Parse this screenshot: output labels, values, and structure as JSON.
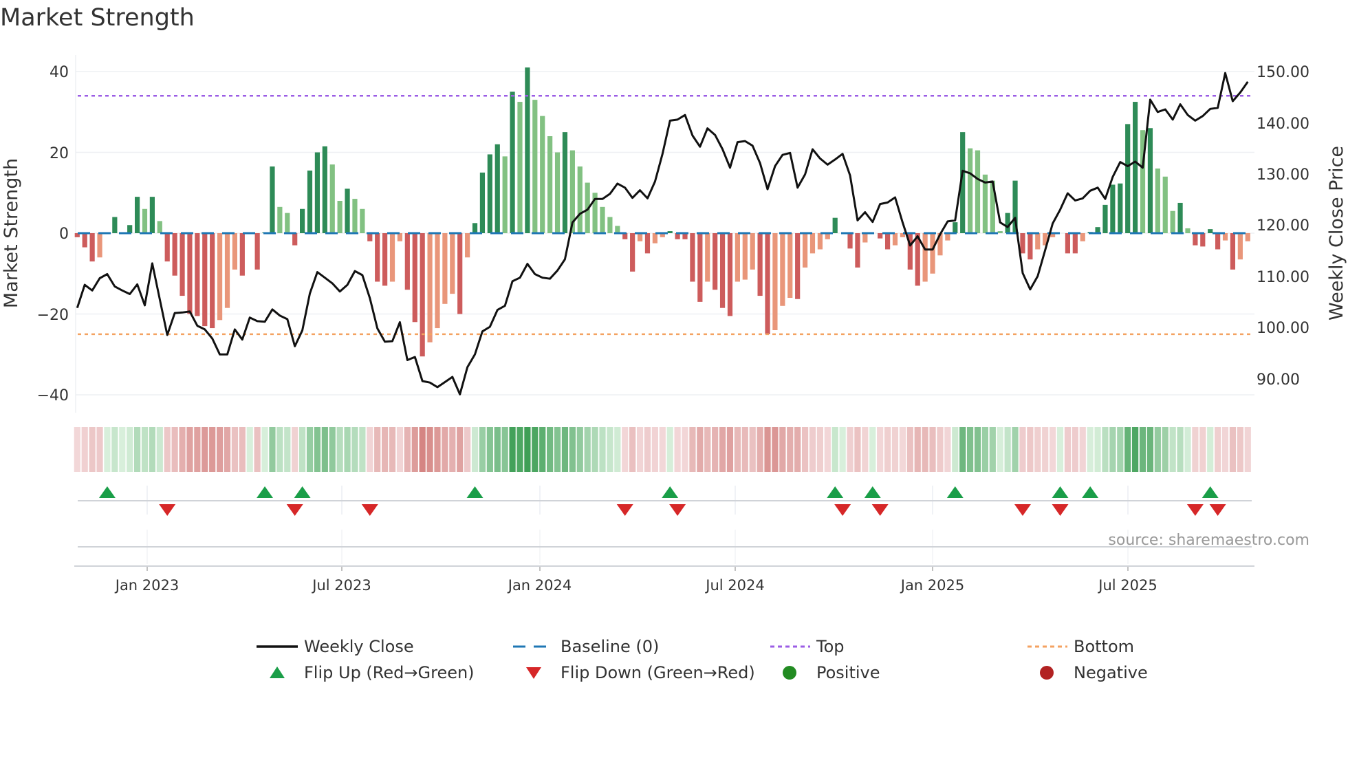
{
  "chart_data": {
    "type": "bar",
    "title": "Market Strength",
    "ylabel": "Market Strength",
    "y2label": "Weekly Close Price",
    "ylim": [
      -44,
      44
    ],
    "y2lim": [
      83.7,
      157.6
    ],
    "y_ticks": [
      "40",
      "20",
      "0",
      "−20",
      "−40"
    ],
    "y_tick_values": [
      40,
      20,
      0,
      -20,
      -40
    ],
    "y2_ticks": [
      "150.00",
      "140.00",
      "130.00",
      "120.00",
      "110.00",
      "100.00",
      "90.00"
    ],
    "y2_tick_values": [
      150,
      140,
      130,
      120,
      110,
      100,
      90
    ],
    "x_ticks": [
      "Jan 2023",
      "Jul 2023",
      "Jan 2024",
      "Jul 2024",
      "Jan 2025",
      "Jul 2025"
    ],
    "x_unit": "weekly bars",
    "top_level": 34,
    "bottom_level": -25,
    "baseline": 0,
    "strength": [
      -1,
      -3.5,
      -7,
      -6,
      0,
      4,
      0,
      2,
      9,
      6,
      9,
      3,
      -7,
      -10.5,
      -15.5,
      -20,
      -20.5,
      -23,
      -23.5,
      -21.5,
      -18.5,
      -9,
      -10.5,
      0,
      -9,
      0.2,
      16.5,
      6.5,
      5,
      -3,
      6,
      15.5,
      20,
      21.5,
      17,
      8,
      11,
      8.5,
      6,
      -2,
      -12,
      -13,
      -12,
      -2,
      -14,
      -22,
      -30.5,
      -27,
      -23.5,
      -17.5,
      -15,
      -20,
      -6,
      2.5,
      15,
      19.5,
      22,
      19,
      35,
      32.5,
      41,
      33,
      29,
      24,
      20,
      25,
      20.5,
      16.5,
      12.5,
      10,
      6.5,
      4,
      1.8,
      -1.5,
      -9.5,
      -2,
      -5,
      -2.5,
      -1,
      0.5,
      -1.5,
      -1.5,
      -12,
      -17,
      -12,
      -14,
      -18.5,
      -20.5,
      -12,
      -11.5,
      -9,
      -15.5,
      -25,
      -24,
      -18,
      -16,
      -16.3,
      -8.5,
      -5,
      -4,
      -1.5,
      3.8,
      0,
      -3.8,
      -8.5,
      -2.3,
      0,
      -1.3,
      -4,
      -3,
      -1,
      -9,
      -13,
      -12,
      -10,
      -5.5,
      -1.8,
      2.7,
      25,
      21,
      20.5,
      14.5,
      13,
      0.5,
      5,
      13,
      -5,
      -6.5,
      -4,
      -3,
      -1,
      0,
      -5,
      -5,
      -2,
      0.3,
      1.5,
      7,
      12,
      12.3,
      27,
      32.5,
      25.5,
      26,
      16,
      14,
      5.5,
      7.5,
      1.2,
      -3,
      -3.3,
      1,
      -4,
      -1.8,
      -9,
      -6.5,
      -2
    ],
    "weekly_close": [
      103.8,
      108.3,
      107.2,
      109.6,
      110.4,
      108.0,
      107.2,
      106.5,
      108.4,
      104.3,
      112.5,
      105.5,
      98.5,
      102.8,
      102.9,
      103.1,
      100.3,
      99.6,
      97.8,
      94.7,
      94.7,
      99.6,
      97.6,
      101.9,
      101.2,
      101.1,
      103.5,
      102.3,
      101.6,
      96.3,
      99.4,
      106.6,
      110.8,
      109.7,
      108.6,
      107.0,
      108.3,
      111.0,
      110.2,
      105.7,
      99.8,
      97.2,
      97.3,
      101.0,
      93.6,
      94.2,
      89.5,
      89.2,
      88.3,
      89.3,
      90.3,
      86.9,
      92.2,
      94.7,
      99.2,
      100.1,
      103.4,
      104.2,
      109.0,
      109.7,
      112.4,
      110.4,
      109.7,
      109.5,
      111.1,
      113.3,
      120.5,
      122.2,
      123.0,
      125.1,
      125.1,
      126.1,
      128.1,
      127.3,
      125.3,
      126.8,
      125.2,
      128.5,
      133.9,
      140.4,
      140.6,
      141.5,
      137.5,
      135.3,
      138.9,
      137.6,
      134.8,
      131.2,
      136.2,
      136.4,
      135.5,
      132.1,
      127.0,
      131.5,
      133.7,
      134.1,
      127.3,
      129.9,
      134.8,
      133.0,
      131.8,
      132.8,
      133.9,
      129.7,
      120.9,
      122.5,
      120.6,
      124.1,
      124.4,
      125.4,
      120.5,
      116.0,
      117.8,
      115.2,
      115.2,
      118.2,
      120.7,
      120.9,
      130.6,
      130.1,
      129.0,
      128.3,
      128.5,
      120.5,
      119.6,
      121.4,
      110.6,
      107.4,
      110.0,
      115.1,
      120.3,
      123.0,
      126.2,
      124.8,
      125.2,
      126.7,
      127.3,
      125.1,
      129.4,
      132.3,
      131.5,
      132.4,
      131.2,
      144.5,
      142.1,
      142.6,
      140.6,
      143.6,
      141.5,
      140.4,
      141.3,
      142.7,
      142.9,
      149.7,
      144.2,
      145.9,
      148.0
    ],
    "flip_up_weeks": [
      4,
      25,
      30,
      53,
      79,
      101,
      106,
      117,
      131,
      135,
      151
    ],
    "flip_down_weeks": [
      12,
      29,
      39,
      73,
      80,
      102,
      107,
      126,
      131,
      149,
      152
    ],
    "legend": {
      "placement": "bottom",
      "items": [
        "Weekly Close",
        "Baseline (0)",
        "Top",
        "Bottom",
        "Flip Up (Red→Green)",
        "Flip Down (Green→Red)",
        "Positive",
        "Negative"
      ]
    },
    "source": "source: sharemaestro.com"
  },
  "colors": {
    "pos_strong": "#2e8b57",
    "pos_weak": "#82c182",
    "neg_strong": "#cd5c5c",
    "neg_weak": "#e9967a",
    "line": "#111111",
    "baseline": "#1f77b4",
    "top": "#9b5de5",
    "bottom": "#f4a261",
    "flip_up": "#1a9e48",
    "flip_down": "#d62728",
    "positive": "#228b22",
    "negative": "#b22222"
  }
}
